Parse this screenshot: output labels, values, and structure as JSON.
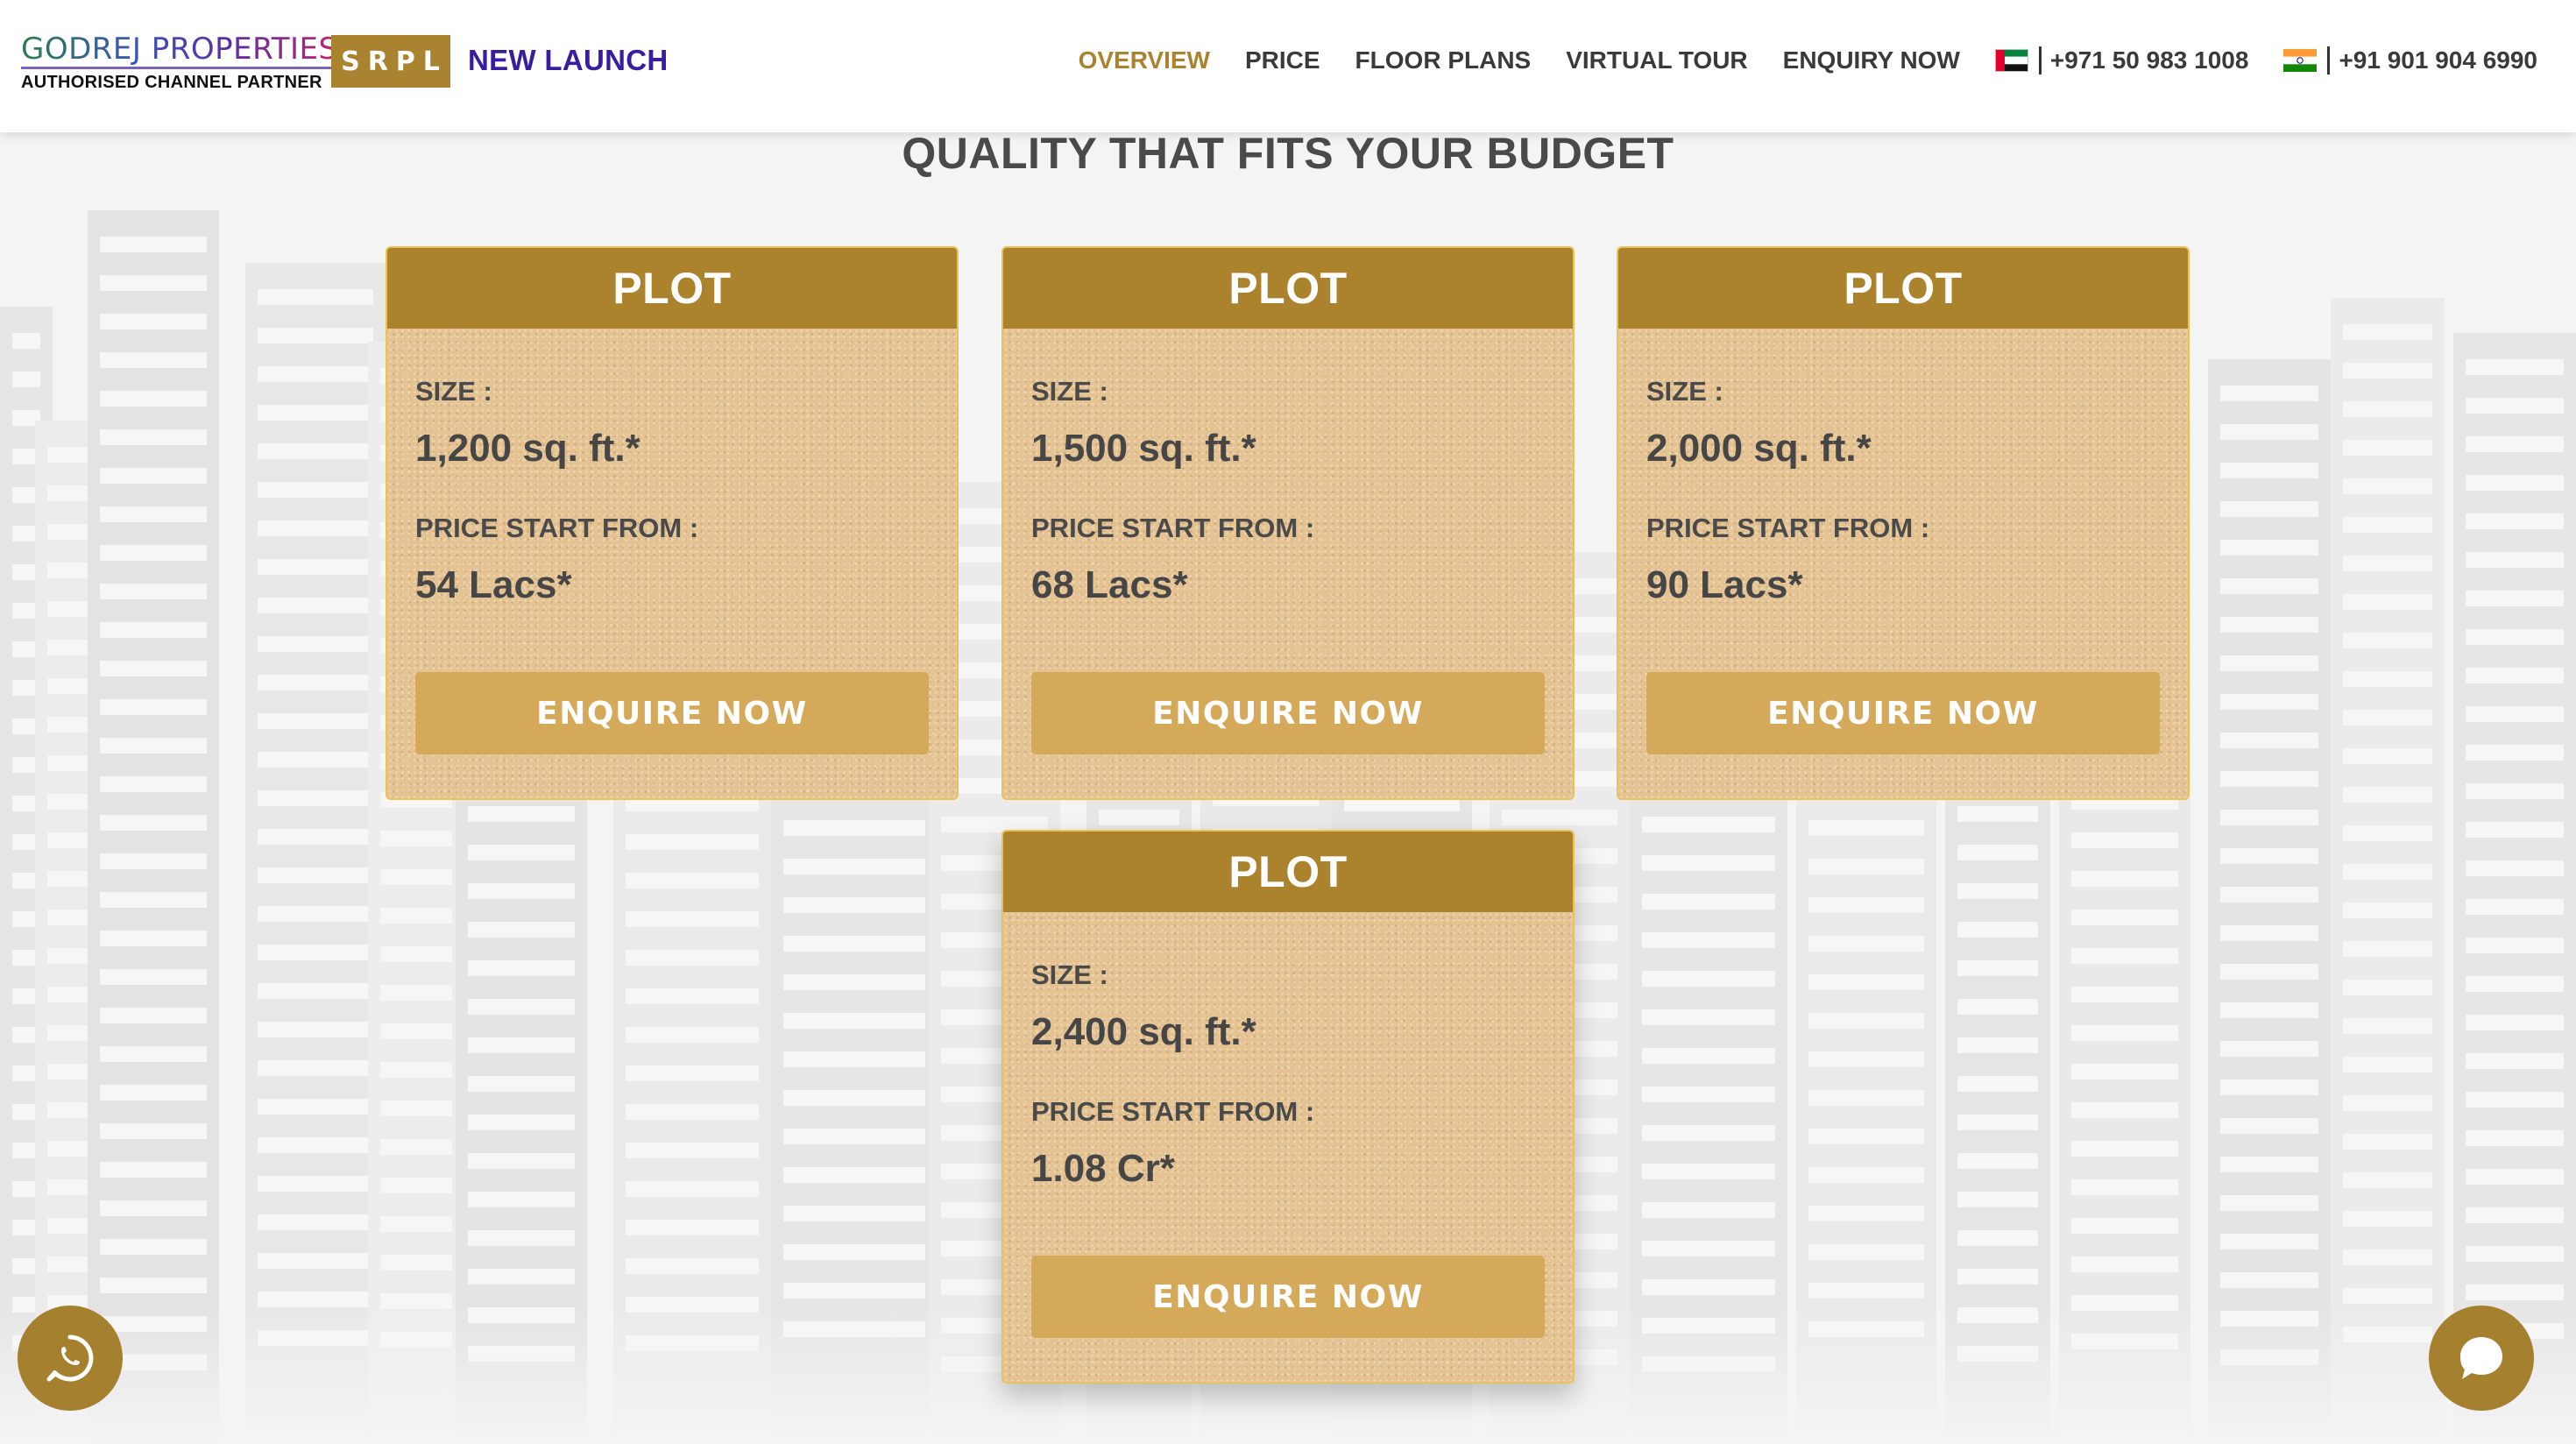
{
  "header": {
    "brand": "GODREJ PROPERTIES",
    "partner_text": "AUTHORISED CHANNEL PARTNER",
    "srpl_logo": "SRPL",
    "new_launch": "NEW LAUNCH",
    "nav": [
      {
        "label": "OVERVIEW",
        "active": true
      },
      {
        "label": "PRICE",
        "active": false
      },
      {
        "label": "FLOOR PLANS",
        "active": false
      },
      {
        "label": "VIRTUAL TOUR",
        "active": false
      },
      {
        "label": "ENQUIRY NOW",
        "active": false
      }
    ],
    "phones": [
      {
        "flag": "uae-flag-icon",
        "number": "+971 50 983 1008"
      },
      {
        "flag": "india-flag-icon",
        "number": "+91 901 904 6990"
      }
    ]
  },
  "section": {
    "title": "QUALITY THAT FITS YOUR BUDGET"
  },
  "cards": [
    {
      "title": "PLOT",
      "size_label": "SIZE :",
      "size": "1,200 sq. ft.*",
      "price_label": "PRICE START FROM :",
      "price": "54 Lacs*",
      "button": "ENQUIRE NOW"
    },
    {
      "title": "PLOT",
      "size_label": "SIZE :",
      "size": "1,500 sq. ft.*",
      "price_label": "PRICE START FROM :",
      "price": "68 Lacs*",
      "button": "ENQUIRE NOW"
    },
    {
      "title": "PLOT",
      "size_label": "SIZE :",
      "size": "2,000 sq. ft.*",
      "price_label": "PRICE START FROM :",
      "price": "90 Lacs*",
      "button": "ENQUIRE NOW"
    },
    {
      "title": "PLOT",
      "size_label": "SIZE :",
      "size": "2,400 sq. ft.*",
      "price_label": "PRICE START FROM :",
      "price": "1.08 Cr*",
      "button": "ENQUIRE NOW"
    }
  ],
  "floating": {
    "whatsapp_icon": "whatsapp-icon",
    "chat_icon": "chat-bubble-icon"
  },
  "colors": {
    "accent_gold": "#ab832d",
    "button_gold": "#d5a95a",
    "nav_active": "#a98330",
    "new_launch": "#3a1ca0"
  }
}
